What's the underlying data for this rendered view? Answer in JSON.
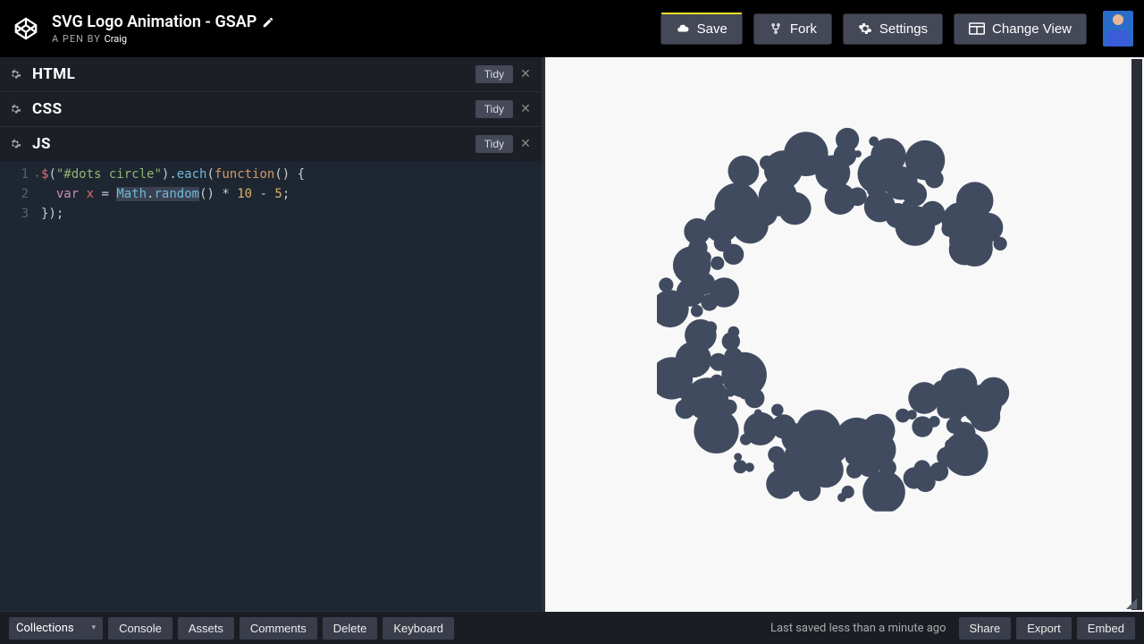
{
  "header": {
    "title": "SVG Logo Animation - GSAP",
    "byline_prefix": "A PEN BY",
    "author": "Craig",
    "buttons": {
      "save": "Save",
      "fork": "Fork",
      "settings": "Settings",
      "change_view": "Change View"
    }
  },
  "editors": {
    "html": {
      "label": "HTML",
      "tidy": "Tidy"
    },
    "css": {
      "label": "CSS",
      "tidy": "Tidy"
    },
    "js": {
      "label": "JS",
      "tidy": "Tidy"
    }
  },
  "code": {
    "line1": {
      "num": "1",
      "selector": "\"#dots circle\"",
      "each": "each",
      "fn": "function"
    },
    "line2": {
      "num": "2",
      "var": "var",
      "x": "x",
      "math": "Math",
      "random": "random",
      "mul": "10",
      "sub": "5"
    },
    "line3": {
      "num": "3"
    }
  },
  "footer": {
    "collections": "Collections",
    "console": "Console",
    "assets": "Assets",
    "comments": "Comments",
    "delete": "Delete",
    "keyboard": "Keyboard",
    "status": "Last saved less than a minute ago",
    "share": "Share",
    "export": "Export",
    "embed": "Embed"
  },
  "preview": {
    "fill": "#414b60"
  }
}
